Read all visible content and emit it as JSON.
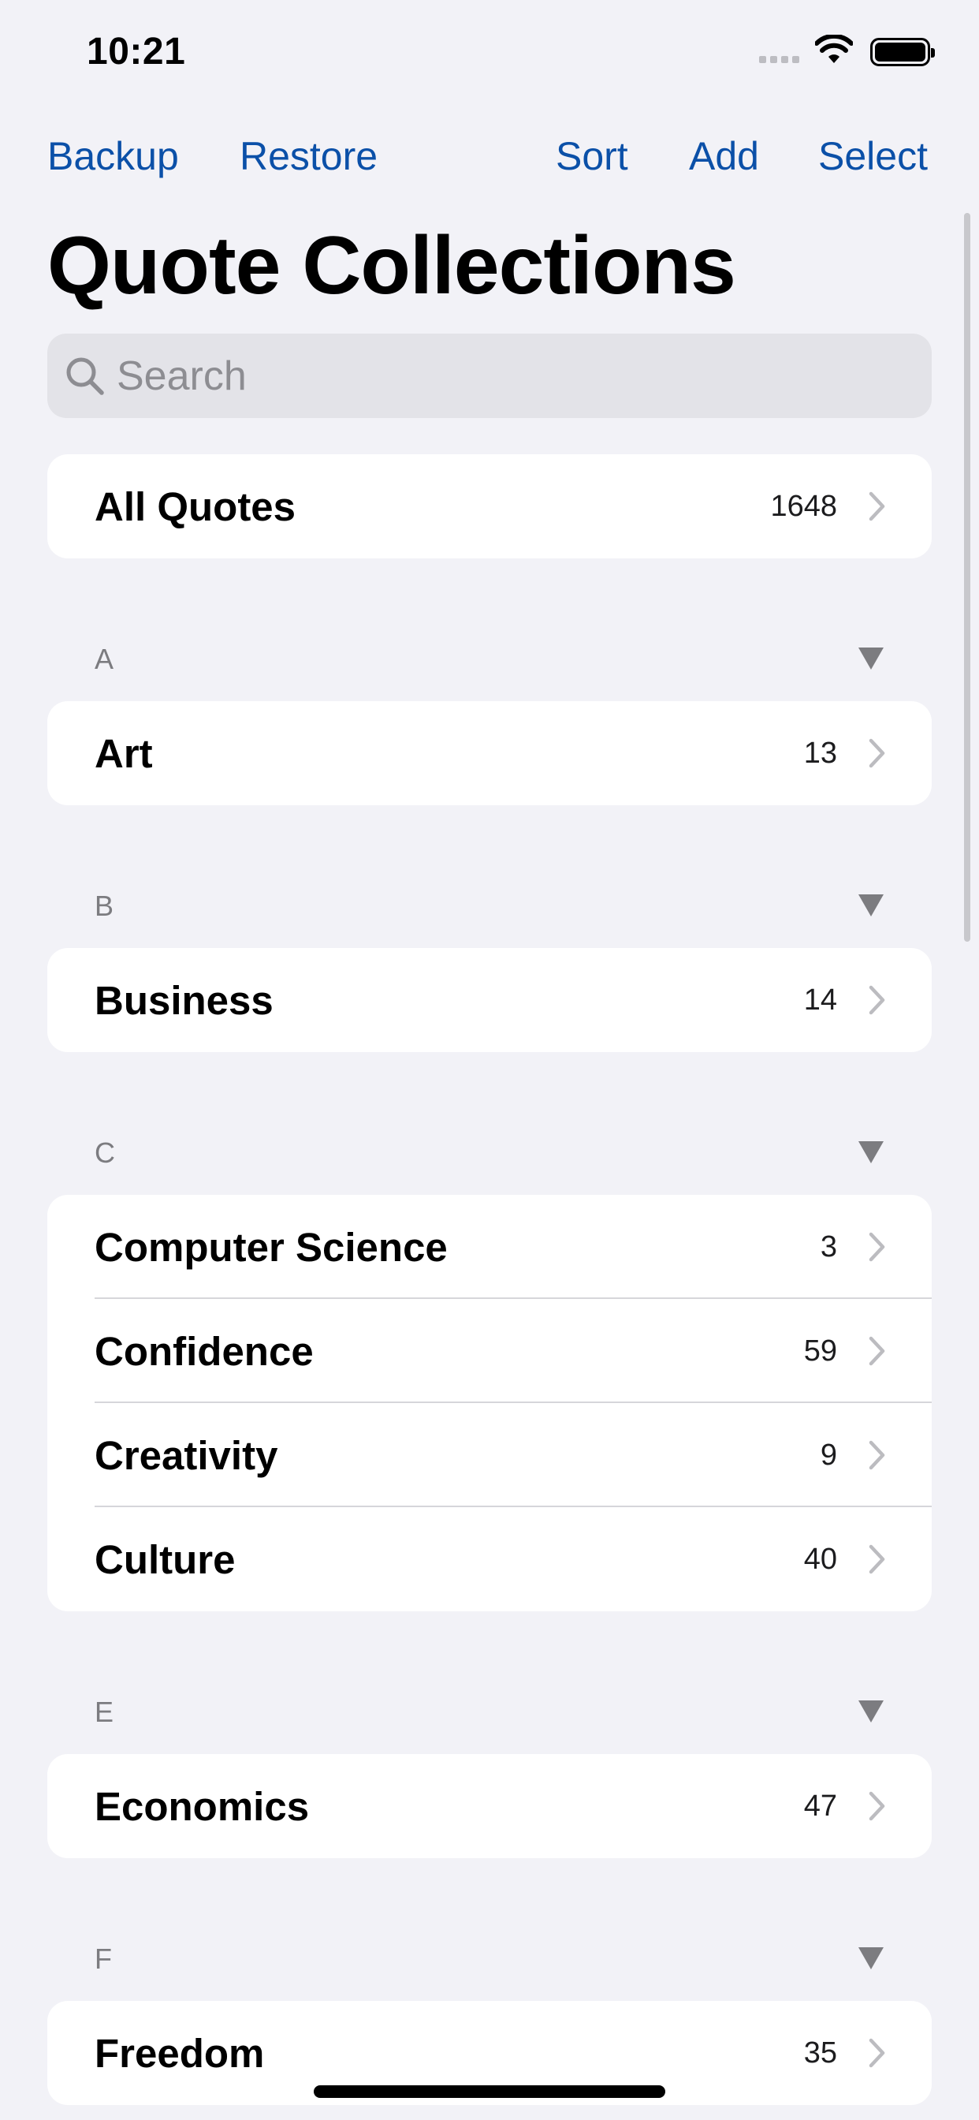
{
  "status_bar": {
    "time": "10:21"
  },
  "nav": {
    "backup": "Backup",
    "restore": "Restore",
    "sort": "Sort",
    "add": "Add",
    "select": "Select"
  },
  "title": "Quote Collections",
  "search": {
    "placeholder": "Search"
  },
  "all_quotes": {
    "label": "All Quotes",
    "count": "1648"
  },
  "sections": [
    {
      "letter": "A",
      "items": [
        {
          "label": "Art",
          "count": "13"
        }
      ]
    },
    {
      "letter": "B",
      "items": [
        {
          "label": "Business",
          "count": "14"
        }
      ]
    },
    {
      "letter": "C",
      "items": [
        {
          "label": "Computer Science",
          "count": "3"
        },
        {
          "label": "Confidence",
          "count": "59"
        },
        {
          "label": "Creativity",
          "count": "9"
        },
        {
          "label": "Culture",
          "count": "40"
        }
      ]
    },
    {
      "letter": "E",
      "items": [
        {
          "label": "Economics",
          "count": "47"
        }
      ]
    },
    {
      "letter": "F",
      "items": [
        {
          "label": "Freedom",
          "count": "35"
        }
      ]
    }
  ],
  "colors": {
    "accent": "#0b50a8",
    "background": "#f2f2f7"
  }
}
